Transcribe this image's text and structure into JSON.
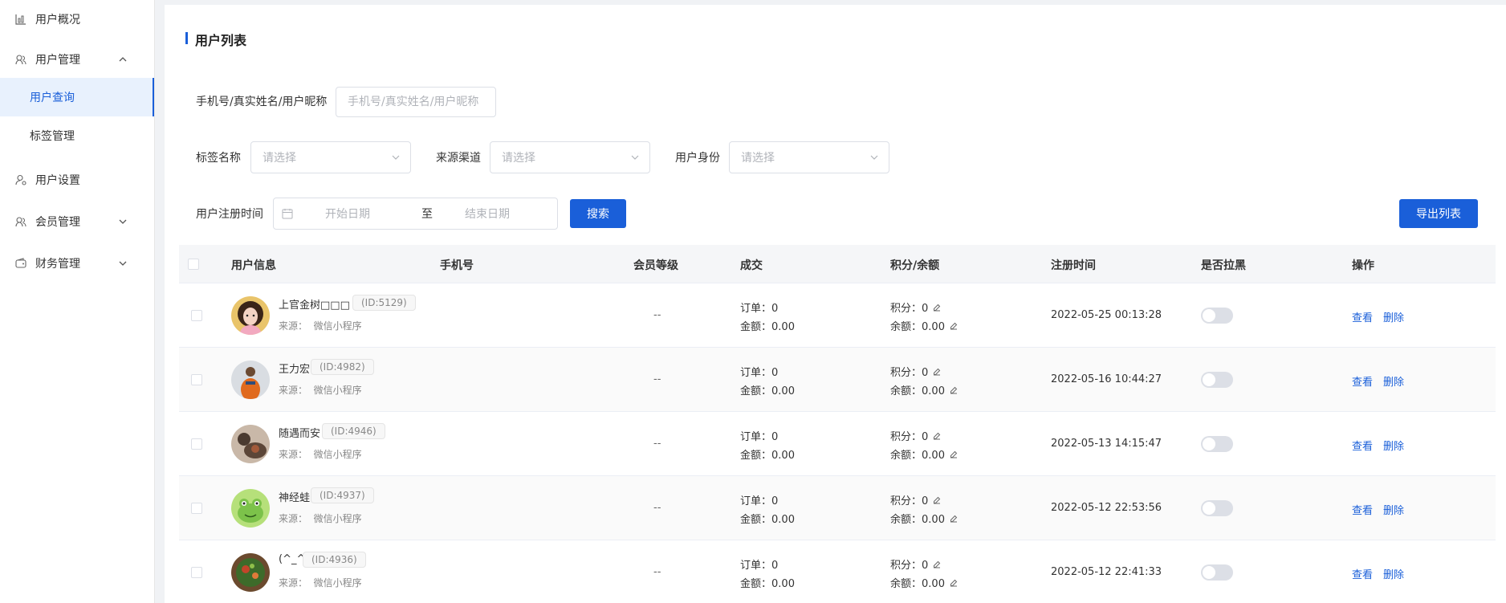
{
  "sidebar": {
    "items": [
      {
        "label": "用户概况",
        "icon": "chart-icon"
      },
      {
        "label": "用户管理",
        "icon": "users-icon",
        "expanded": true
      },
      {
        "label": "用户查询",
        "sub": true,
        "active": true
      },
      {
        "label": "标签管理",
        "sub": true
      },
      {
        "label": "用户设置",
        "icon": "user-settings-icon"
      },
      {
        "label": "会员管理",
        "icon": "members-icon"
      },
      {
        "label": "财务管理",
        "icon": "wallet-icon"
      }
    ]
  },
  "page": {
    "title": "用户列表"
  },
  "filters": {
    "keyword_label": "手机号/真实姓名/用户昵称",
    "keyword_placeholder": "手机号/真实姓名/用户昵称",
    "tag_label": "标签名称",
    "tag_placeholder": "请选择",
    "channel_label": "来源渠道",
    "channel_placeholder": "请选择",
    "identity_label": "用户身份",
    "identity_placeholder": "请选择",
    "date_label": "用户注册时间",
    "date_start": "开始日期",
    "date_sep": "至",
    "date_end": "结束日期",
    "search_label": "搜索",
    "export_label": "导出列表"
  },
  "table": {
    "headers": [
      "用户信息",
      "手机号",
      "会员等级",
      "成交",
      "积分/余额",
      "注册时间",
      "是否拉黑",
      "操作"
    ],
    "labels": {
      "source": "来源：",
      "order": "订单：",
      "amount": "金额：",
      "points": "积分：",
      "balance": "余额：",
      "view": "查看",
      "delete": "删除"
    },
    "rows": [
      {
        "name": "上官金树□□□",
        "id": "(ID:5129)",
        "source": "微信小程序",
        "level": "--",
        "orders": "0",
        "amount": "0.00",
        "points": "0",
        "balance": "0.00",
        "registered": "2022-05-25 00:13:28",
        "blacklisted": false
      },
      {
        "name": "王力宏",
        "id": "(ID:4982)",
        "source": "微信小程序",
        "level": "--",
        "orders": "0",
        "amount": "0.00",
        "points": "0",
        "balance": "0.00",
        "registered": "2022-05-16 10:44:27",
        "blacklisted": false
      },
      {
        "name": "随遇而安",
        "id": "(ID:4946)",
        "source": "微信小程序",
        "level": "--",
        "orders": "0",
        "amount": "0.00",
        "points": "0",
        "balance": "0.00",
        "registered": "2022-05-13 14:15:47",
        "blacklisted": false
      },
      {
        "name": "神经蛙",
        "id": "(ID:4937)",
        "source": "微信小程序",
        "level": "--",
        "orders": "0",
        "amount": "0.00",
        "points": "0",
        "balance": "0.00",
        "registered": "2022-05-12 22:53:56",
        "blacklisted": false
      },
      {
        "name": "(^_^)",
        "id": "(ID:4936)",
        "source": "微信小程序",
        "level": "--",
        "orders": "0",
        "amount": "0.00",
        "points": "0",
        "balance": "0.00",
        "registered": "2022-05-12 22:41:33",
        "blacklisted": false
      }
    ]
  },
  "colors": {
    "accent": "#1a5fd9",
    "active_bg": "#e8f1fd",
    "header_bg": "#f5f6f8"
  }
}
